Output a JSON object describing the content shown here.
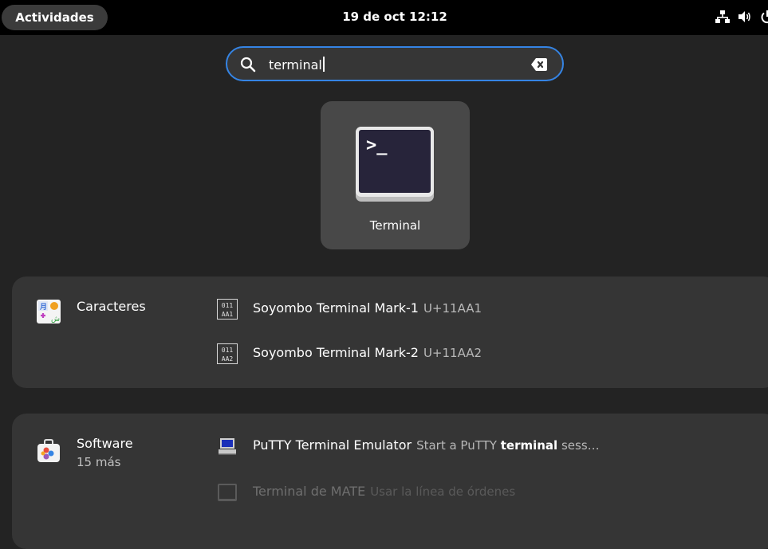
{
  "topbar": {
    "activities_label": "Actividades",
    "clock": "19 de oct  12:12",
    "tray_icons": [
      "network-icon",
      "volume-icon",
      "power-icon"
    ]
  },
  "search": {
    "value": "terminal"
  },
  "app_result": {
    "label": "Terminal",
    "icon": "terminal-app-icon",
    "prompt_glyph": ">_"
  },
  "providers": {
    "characters": {
      "name": "Caracteres",
      "icon": "characters-app-icon",
      "results": [
        {
          "title": "Soyombo Terminal Mark-1",
          "code": "U+11AA1",
          "glyph_top": "011",
          "glyph_bottom": "AA1"
        },
        {
          "title": "Soyombo Terminal Mark-2",
          "code": "U+11AA2",
          "glyph_top": "011",
          "glyph_bottom": "AA2"
        }
      ]
    },
    "software": {
      "name": "Software",
      "more": "15 más",
      "icon": "software-app-icon",
      "results": [
        {
          "title": "PuTTY Terminal Emulator",
          "desc_prefix": "Start a PuTTY ",
          "desc_bold": "terminal",
          "desc_suffix": " sess…",
          "icon": "putty-icon"
        },
        {
          "title": "Terminal de MATE",
          "desc": "Usar la línea de órdenes",
          "icon": "mate-terminal-icon"
        }
      ]
    }
  },
  "colors": {
    "accent": "#3584e4",
    "background": "#232323",
    "topbar": "#000000"
  }
}
